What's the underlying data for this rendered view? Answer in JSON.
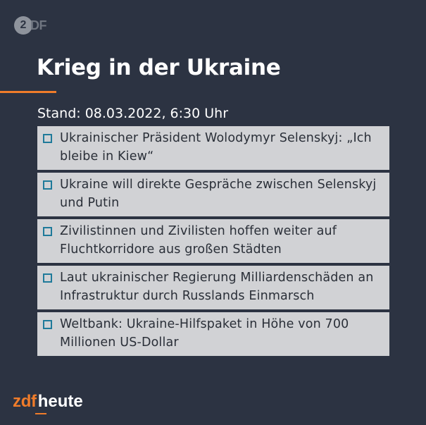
{
  "brand": {
    "badge": "2",
    "badge_text": "DF",
    "footer_prefix": "zdf",
    "footer_suffix": "heute",
    "accent_color": "#f07c2a",
    "background_color": "#2c3342"
  },
  "header": {
    "title": "Krieg in der Ukraine",
    "stand": "Stand: 08.03.2022, 6:30 Uhr"
  },
  "items": [
    {
      "text": "Ukrainischer Präsident Wolodymyr Selenskyj: „Ich bleibe in Kiew“"
    },
    {
      "text": "Ukraine will direkte Gespräche zwischen Selenskyj und Putin"
    },
    {
      "text": "Zivilistinnen und Zivilisten hoffen weiter auf Fluchtkorridore aus großen Städten"
    },
    {
      "text": "Laut ukrainischer Regierung Milliardenschäden an Infrastruktur durch Russlands Einmarsch"
    },
    {
      "text": "Weltbank: Ukraine-Hilfspaket in Höhe von 700 Millionen US-Dollar"
    }
  ]
}
